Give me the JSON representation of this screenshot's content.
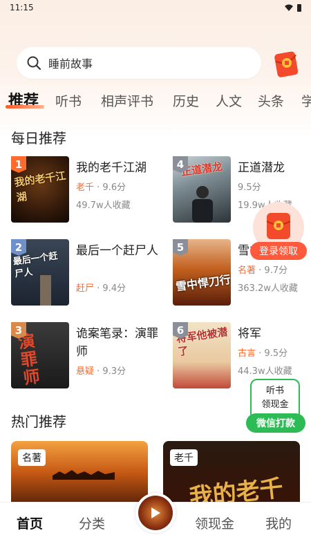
{
  "status": {
    "time": "11:15"
  },
  "search": {
    "placeholder": "睡前故事"
  },
  "tabs": [
    "推荐",
    "听书",
    "相声评书",
    "历史",
    "人文",
    "头条",
    "学"
  ],
  "daily": {
    "title": "每日推荐",
    "books": [
      {
        "rank": "1",
        "name": "我的老千江湖",
        "tag": "老千",
        "score": "9.6分",
        "fav": "49.7w人收藏",
        "cover_text": "我的老千江湖",
        "rank_color": "#ff6b2c"
      },
      {
        "rank": "4",
        "name": "正道潜龙",
        "tag": "",
        "score": "9.5分",
        "fav": "19.9w人收藏",
        "cover_text": "正道潜龙",
        "rank_color": "#8a8f99"
      },
      {
        "rank": "2",
        "name": "最后一个赶尸人",
        "tag": "赶尸",
        "score": "9.4分",
        "fav": "",
        "cover_text": "最后一个赶尸人",
        "rank_color": "#6f90c8"
      },
      {
        "rank": "5",
        "name": "雪中",
        "tag": "名著",
        "score": "9.7分",
        "fav": "363.2w人收藏",
        "cover_text": "雪中悍刀行",
        "rank_color": "#8a8f99"
      },
      {
        "rank": "3",
        "name": "诡案笔录：演罪师",
        "tag": "悬疑",
        "score": "9.3分",
        "fav": "",
        "cover_text": "演罪师",
        "rank_color": "#d98a4a"
      },
      {
        "rank": "6",
        "name": "将军",
        "tag": "古言",
        "score": "9.5分",
        "fav": "44.3w人收藏",
        "cover_text": "将军他被潜了",
        "rank_color": "#8a8f99"
      }
    ]
  },
  "hot": {
    "title": "热门推荐",
    "cards": [
      {
        "tag": "名著"
      },
      {
        "tag": "老千"
      }
    ]
  },
  "float_redpack": {
    "label": "登录领取"
  },
  "wechat_float": {
    "line1": "听书",
    "line2": "领现金",
    "button": "微信打款"
  },
  "bottom_nav": [
    "首页",
    "分类",
    "领现金",
    "我的"
  ],
  "colors": {
    "accent": "#ff6a2c",
    "wechat": "#2cbb54"
  }
}
